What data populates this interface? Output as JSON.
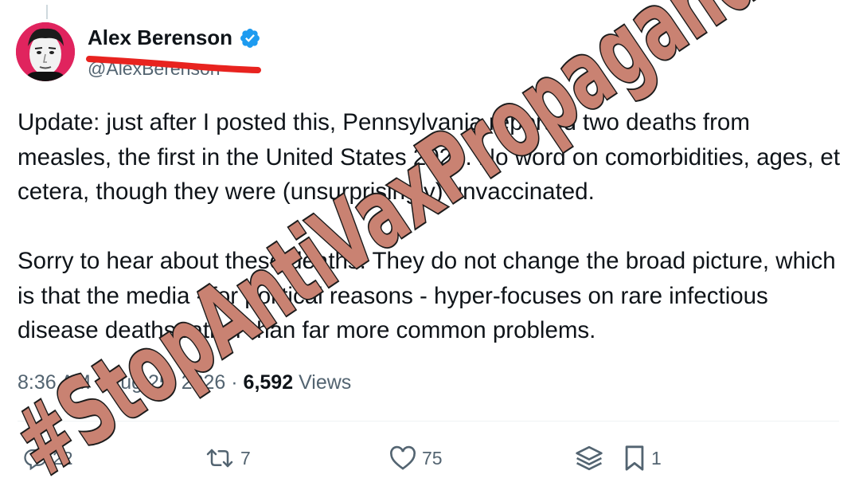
{
  "author": {
    "display_name": "Alex Berenson",
    "handle": "@AlexBerenson",
    "verified_icon": "verified-badge-icon",
    "accent_color": "#1d9bf0"
  },
  "tweet": {
    "paragraphs": [
      "Update: just after I posted this, Pennsylvania reported two deaths from measles, the first in the United States 2026. No word on comorbidities, ages, et cetera, though they were (unsurprisingly) unvaccinated.",
      "Sorry to hear about these deaths. They do not change the broad picture, which is that the media - for political reasons - hyper-focuses on rare infectious disease deaths rather than far more common problems."
    ],
    "time": "8:36 AM",
    "separator1": " · ",
    "date": "Aug 25, 2026",
    "separator2": " · ",
    "views_count": "6,592",
    "views_label": "Views"
  },
  "actions": {
    "replies": "22",
    "reposts": "7",
    "likes": "75",
    "bookmarks": "1"
  },
  "overlay": {
    "text": "#StopAntiVaxPropaganda",
    "fill_color": "#c98272",
    "stroke_color": "#1a1a1a",
    "strike_color": "#e8231f"
  }
}
